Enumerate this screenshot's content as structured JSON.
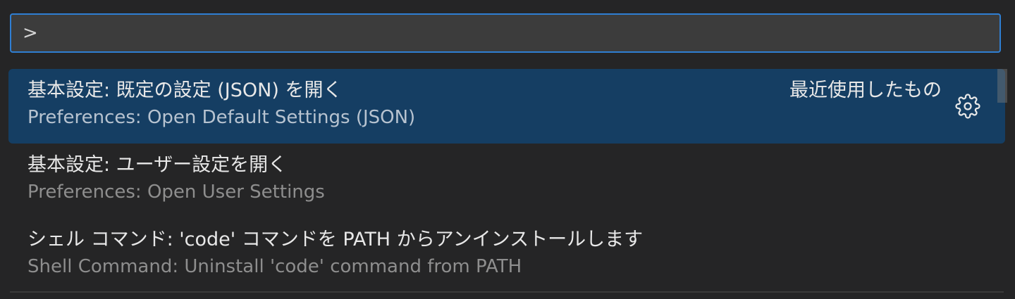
{
  "input": {
    "value": ">"
  },
  "items": [
    {
      "label": "基本設定: 既定の設定 (JSON) を開く",
      "detail": "Preferences: Open Default Settings (JSON)",
      "badge": "最近使用したもの",
      "icon": "gear-icon"
    },
    {
      "label": "基本設定: ユーザー設定を開く",
      "detail": "Preferences: Open User Settings"
    },
    {
      "label": "シェル コマンド: 'code' コマンドを PATH からアンインストールします",
      "detail": "Shell Command: Uninstall 'code' command from PATH"
    }
  ],
  "colors": {
    "background": "#252526",
    "input_border": "#2f7fd3",
    "selected_row": "#153e63"
  }
}
